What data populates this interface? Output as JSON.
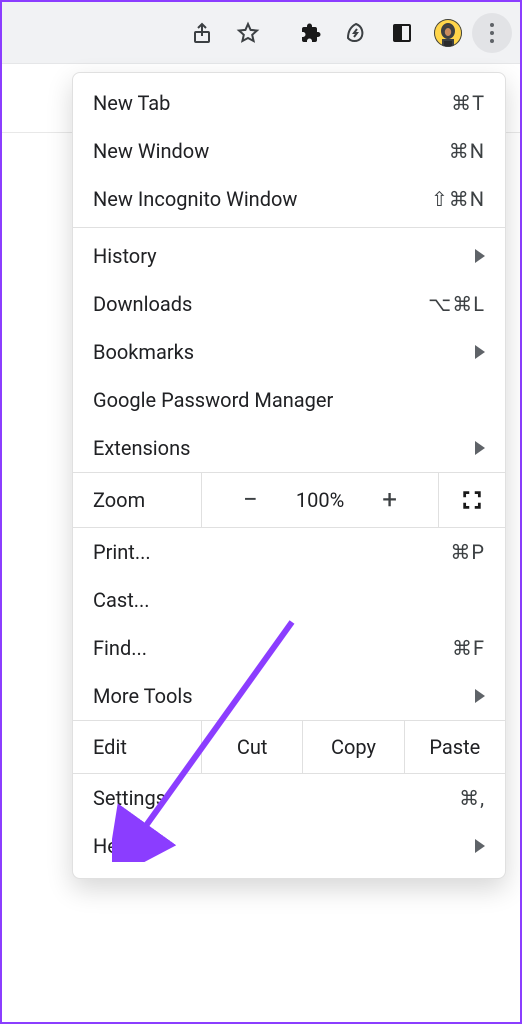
{
  "menu": {
    "new_tab": {
      "label": "New Tab",
      "shortcut": "⌘T"
    },
    "new_window": {
      "label": "New Window",
      "shortcut": "⌘N"
    },
    "incognito": {
      "label": "New Incognito Window",
      "shortcut": "⇧⌘N"
    },
    "history": {
      "label": "History"
    },
    "downloads": {
      "label": "Downloads",
      "shortcut": "⌥⌘L"
    },
    "bookmarks": {
      "label": "Bookmarks"
    },
    "pwm": {
      "label": "Google Password Manager"
    },
    "extensions": {
      "label": "Extensions"
    },
    "zoom": {
      "label": "Zoom",
      "value": "100%"
    },
    "print": {
      "label": "Print...",
      "shortcut": "⌘P"
    },
    "cast": {
      "label": "Cast..."
    },
    "find": {
      "label": "Find...",
      "shortcut": "⌘F"
    },
    "more_tools": {
      "label": "More Tools"
    },
    "edit": {
      "label": "Edit",
      "cut": "Cut",
      "copy": "Copy",
      "paste": "Paste"
    },
    "settings": {
      "label": "Settings",
      "shortcut": "⌘,"
    },
    "help": {
      "label": "Help"
    }
  }
}
